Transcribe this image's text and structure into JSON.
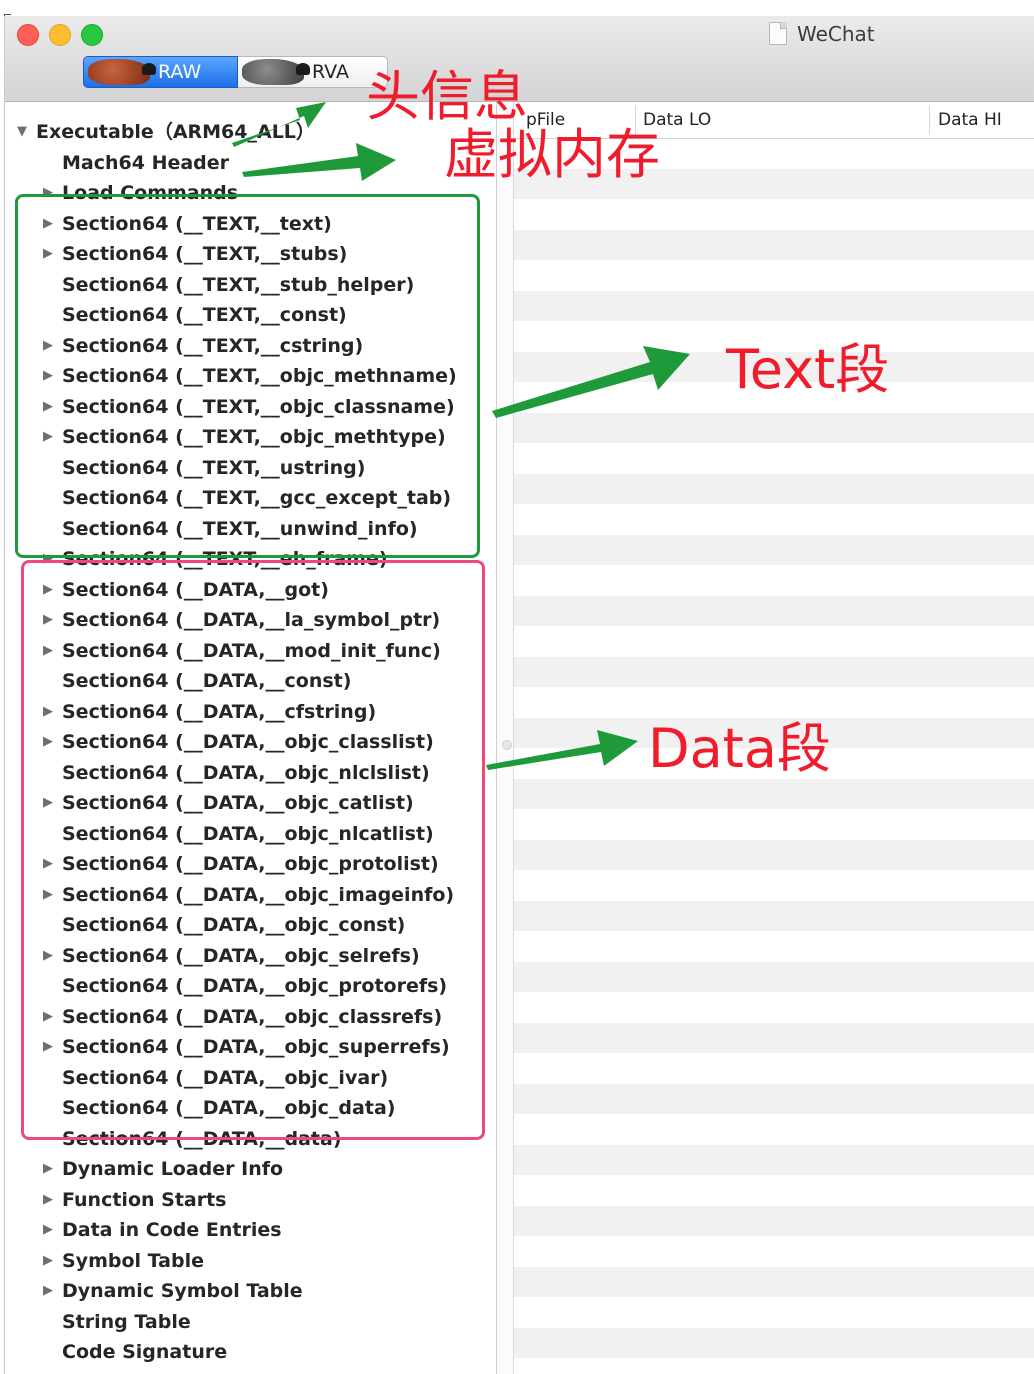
{
  "window": {
    "title": "WeChat"
  },
  "view_toggle": {
    "raw_label": "RAW",
    "rva_label": "RVA"
  },
  "table": {
    "columns": [
      "pFile",
      "Data LO",
      "Data HI"
    ]
  },
  "tree": [
    {
      "label": "Executable（ARM64_ALL）",
      "arrow": "down",
      "indent": 0
    },
    {
      "label": "Mach64 Header",
      "arrow": "none",
      "indent": 1
    },
    {
      "label": "Load Commands",
      "arrow": "right",
      "indent": 1
    },
    {
      "label": "Section64 (__TEXT,__text)",
      "arrow": "right",
      "indent": 1
    },
    {
      "label": "Section64 (__TEXT,__stubs)",
      "arrow": "right",
      "indent": 1
    },
    {
      "label": "Section64 (__TEXT,__stub_helper)",
      "arrow": "none",
      "indent": 1
    },
    {
      "label": "Section64 (__TEXT,__const)",
      "arrow": "none",
      "indent": 1
    },
    {
      "label": "Section64 (__TEXT,__cstring)",
      "arrow": "right",
      "indent": 1
    },
    {
      "label": "Section64 (__TEXT,__objc_methname)",
      "arrow": "right",
      "indent": 1
    },
    {
      "label": "Section64 (__TEXT,__objc_classname)",
      "arrow": "right",
      "indent": 1
    },
    {
      "label": "Section64 (__TEXT,__objc_methtype)",
      "arrow": "right",
      "indent": 1
    },
    {
      "label": "Section64 (__TEXT,__ustring)",
      "arrow": "none",
      "indent": 1
    },
    {
      "label": "Section64 (__TEXT,__gcc_except_tab)",
      "arrow": "none",
      "indent": 1
    },
    {
      "label": "Section64 (__TEXT,__unwind_info)",
      "arrow": "none",
      "indent": 1
    },
    {
      "label": "Section64 (__TEXT,__eh_frame)",
      "arrow": "right",
      "indent": 1
    },
    {
      "label": "Section64 (__DATA,__got)",
      "arrow": "right",
      "indent": 1
    },
    {
      "label": "Section64 (__DATA,__la_symbol_ptr)",
      "arrow": "right",
      "indent": 1
    },
    {
      "label": "Section64 (__DATA,__mod_init_func)",
      "arrow": "right",
      "indent": 1
    },
    {
      "label": "Section64 (__DATA,__const)",
      "arrow": "none",
      "indent": 1
    },
    {
      "label": "Section64 (__DATA,__cfstring)",
      "arrow": "right",
      "indent": 1
    },
    {
      "label": "Section64 (__DATA,__objc_classlist)",
      "arrow": "right",
      "indent": 1
    },
    {
      "label": "Section64 (__DATA,__objc_nlclslist)",
      "arrow": "none",
      "indent": 1
    },
    {
      "label": "Section64 (__DATA,__objc_catlist)",
      "arrow": "right",
      "indent": 1
    },
    {
      "label": "Section64 (__DATA,__objc_nlcatlist)",
      "arrow": "none",
      "indent": 1
    },
    {
      "label": "Section64 (__DATA,__objc_protolist)",
      "arrow": "right",
      "indent": 1
    },
    {
      "label": "Section64 (__DATA,__objc_imageinfo)",
      "arrow": "right",
      "indent": 1
    },
    {
      "label": "Section64 (__DATA,__objc_const)",
      "arrow": "none",
      "indent": 1
    },
    {
      "label": "Section64 (__DATA,__objc_selrefs)",
      "arrow": "right",
      "indent": 1
    },
    {
      "label": "Section64 (__DATA,__objc_protorefs)",
      "arrow": "none",
      "indent": 1
    },
    {
      "label": "Section64 (__DATA,__objc_classrefs)",
      "arrow": "right",
      "indent": 1
    },
    {
      "label": "Section64 (__DATA,__objc_superrefs)",
      "arrow": "right",
      "indent": 1
    },
    {
      "label": "Section64 (__DATA,__objc_ivar)",
      "arrow": "none",
      "indent": 1
    },
    {
      "label": "Section64 (__DATA,__objc_data)",
      "arrow": "none",
      "indent": 1
    },
    {
      "label": "Section64 (__DATA,__data)",
      "arrow": "none",
      "indent": 1
    },
    {
      "label": "Dynamic Loader Info",
      "arrow": "right",
      "indent": 1
    },
    {
      "label": "Function Starts",
      "arrow": "right",
      "indent": 1
    },
    {
      "label": "Data in Code Entries",
      "arrow": "right",
      "indent": 1
    },
    {
      "label": "Symbol Table",
      "arrow": "right",
      "indent": 1
    },
    {
      "label": "Dynamic Symbol Table",
      "arrow": "right",
      "indent": 1
    },
    {
      "label": "String Table",
      "arrow": "none",
      "indent": 1
    },
    {
      "label": "Code Signature",
      "arrow": "none",
      "indent": 1
    }
  ],
  "annotations": {
    "header": "头信息",
    "virtual_memory": "虚拟内存",
    "text_segment": "Text段",
    "data_segment": "Data段",
    "red": "#f01c2c",
    "green": "#1f9a3a",
    "pink": "#ec4a7a"
  }
}
